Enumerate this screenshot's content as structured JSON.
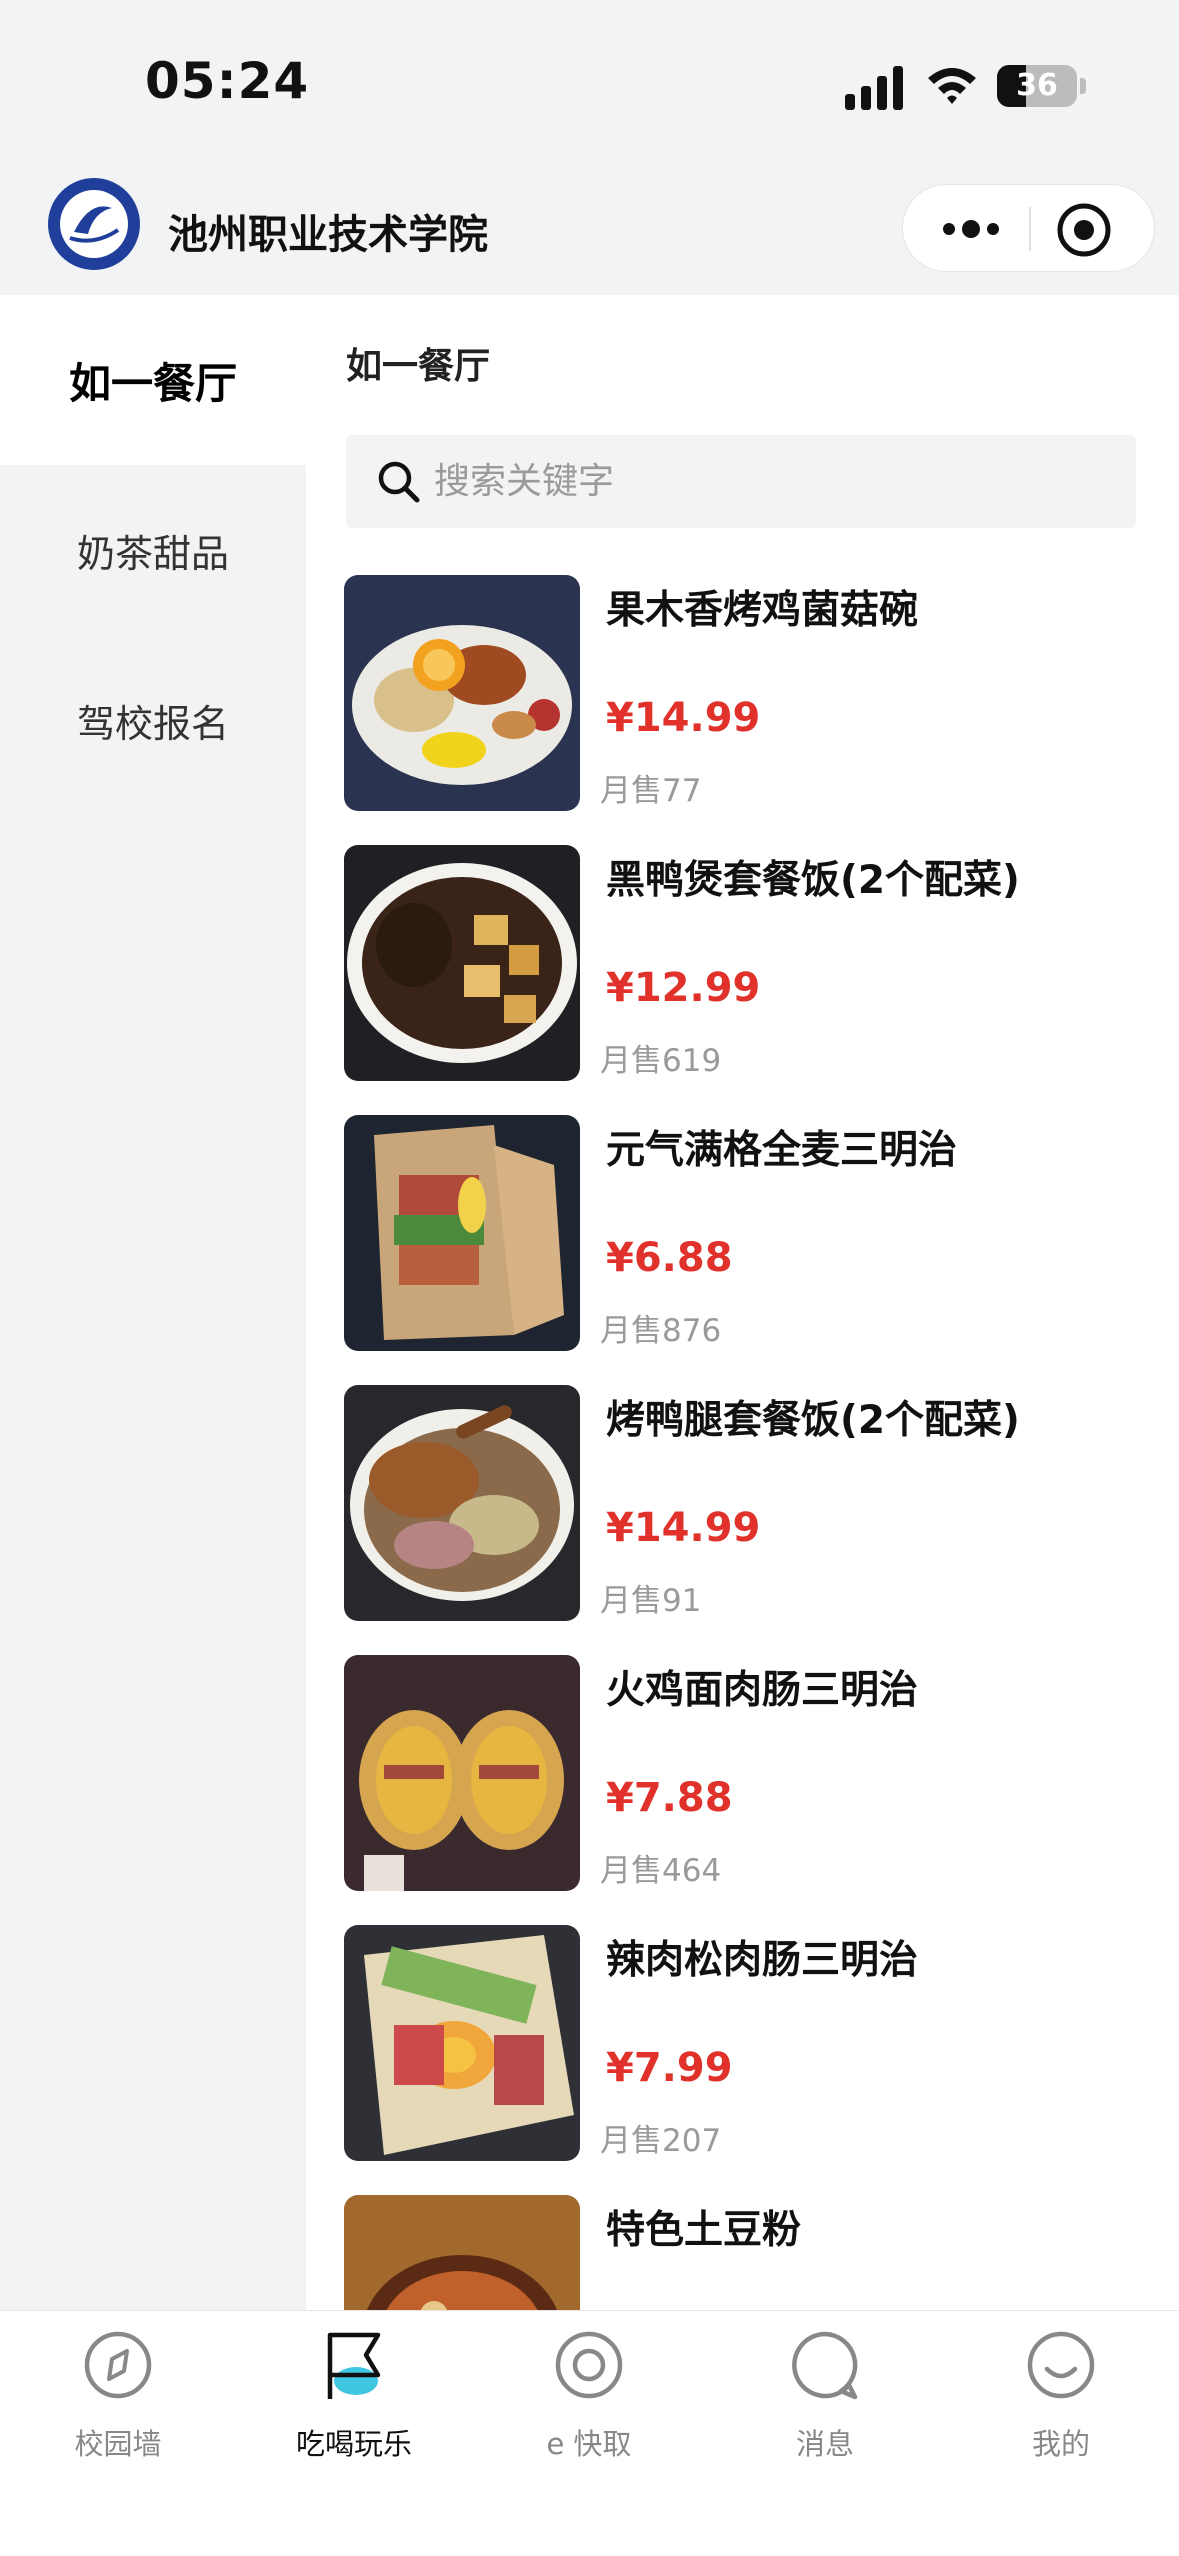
{
  "status_bar": {
    "time": "05:24",
    "battery": "36",
    "battery_level": 0.36
  },
  "header": {
    "title": "池州职业技术学院"
  },
  "sidebar": {
    "items": [
      {
        "label": "如一餐厅",
        "active": true
      },
      {
        "label": "奶茶甜品",
        "active": false
      },
      {
        "label": "驾校报名",
        "active": false
      }
    ]
  },
  "main": {
    "section_title": "如一餐厅",
    "search": {
      "placeholder": "搜索关键字"
    },
    "products": [
      {
        "name": "果木香烤鸡菌菇碗",
        "price": "¥14.99",
        "sales": "月售77"
      },
      {
        "name": "黑鸭煲套餐饭(2个配菜)",
        "price": "¥12.99",
        "sales": "月售619"
      },
      {
        "name": "元气满格全麦三明治",
        "price": "¥6.88",
        "sales": "月售876"
      },
      {
        "name": "烤鸭腿套餐饭(2个配菜)",
        "price": "¥14.99",
        "sales": "月售91"
      },
      {
        "name": "火鸡面肉肠三明治",
        "price": "¥7.88",
        "sales": "月售464"
      },
      {
        "name": "辣肉松肉肠三明治",
        "price": "¥7.99",
        "sales": "月售207"
      },
      {
        "name": "特色土豆粉",
        "price": "",
        "sales": ""
      }
    ]
  },
  "tabbar": {
    "items": [
      {
        "label": "校园墙",
        "icon": "compass-icon",
        "active": false
      },
      {
        "label": "吃喝玩乐",
        "icon": "flag-icon",
        "active": true
      },
      {
        "label": "e 快取",
        "icon": "target-icon",
        "active": false
      },
      {
        "label": "消息",
        "icon": "chat-bubble-icon",
        "active": false
      },
      {
        "label": "我的",
        "icon": "smile-icon",
        "active": false
      }
    ]
  },
  "colors": {
    "price": "#e0322b",
    "accent": "#3ec6e0",
    "logo": "#1f3f9a"
  }
}
